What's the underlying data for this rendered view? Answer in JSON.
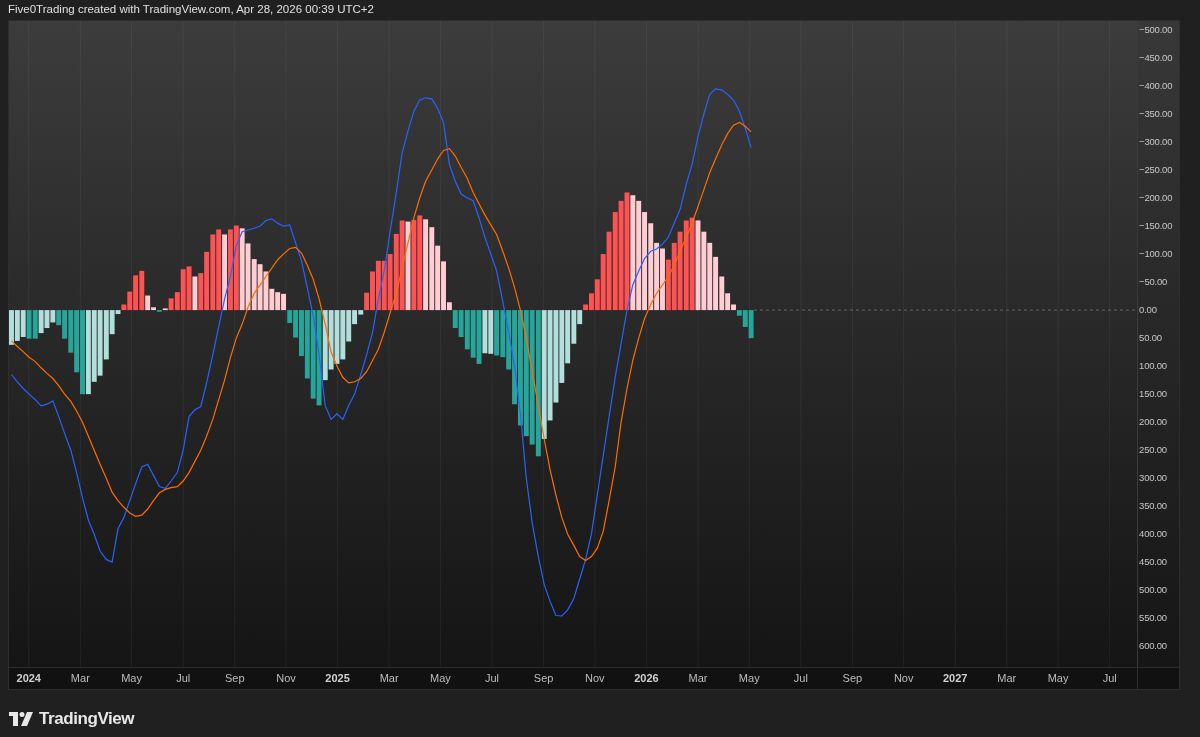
{
  "header": {
    "text": "Five0Trading created with TradingView.com, Apr 28, 2026 00:39 UTC+2"
  },
  "chart": {
    "chart_data": {
      "type": "bar",
      "x": [
        2023.944,
        2023.963,
        2023.982,
        2024.001,
        2024.021,
        2024.04,
        2024.059,
        2024.078,
        2024.097,
        2024.116,
        2024.136,
        2024.155,
        2024.174,
        2024.193,
        2024.212,
        2024.231,
        2024.251,
        2024.27,
        2024.289,
        2024.308,
        2024.327,
        2024.346,
        2024.366,
        2024.385,
        2024.404,
        2024.423,
        2024.442,
        2024.461,
        2024.481,
        2024.5,
        2024.519,
        2024.538,
        2024.557,
        2024.576,
        2024.596,
        2024.615,
        2024.634,
        2024.653,
        2024.672,
        2024.691,
        2024.71,
        2024.73,
        2024.749,
        2024.768,
        2024.787,
        2024.806,
        2024.825,
        2024.845,
        2024.864,
        2024.883,
        2024.902,
        2024.921,
        2024.94,
        2024.96,
        2024.979,
        2024.998,
        2025.017,
        2025.036,
        2025.055,
        2025.075,
        2025.094,
        2025.113,
        2025.132,
        2025.151,
        2025.17,
        2025.19,
        2025.209,
        2025.228,
        2025.247,
        2025.266,
        2025.285,
        2025.305,
        2025.324,
        2025.343,
        2025.362,
        2025.381,
        2025.4,
        2025.42,
        2025.439,
        2025.458,
        2025.477,
        2025.496,
        2025.515,
        2025.535,
        2025.554,
        2025.573,
        2025.592,
        2025.611,
        2025.63,
        2025.65,
        2025.669,
        2025.688,
        2025.707,
        2025.726,
        2025.745,
        2025.765,
        2025.784,
        2025.803,
        2025.822,
        2025.841,
        2025.86,
        2025.879,
        2025.899,
        2025.918,
        2025.937,
        2025.956,
        2025.975,
        2025.994,
        2026.014,
        2026.033,
        2026.052,
        2026.071,
        2026.09,
        2026.109,
        2026.129,
        2026.148,
        2026.167,
        2026.186,
        2026.205,
        2026.224,
        2026.244,
        2026.263,
        2026.282,
        2026.301,
        2026.32,
        2026.339
      ],
      "series": [
        {
          "type": "bar",
          "colors": [
            "#b2dfdb",
            "#b2dfdb",
            "#b2dfdb",
            "#26a69a",
            "#26a69a",
            "#b2dfdb",
            "#b2dfdb",
            "#b2dfdb",
            "#26a69a",
            "#26a69a",
            "#26a69a",
            "#26a69a",
            "#26a69a",
            "#b2dfdb",
            "#b2dfdb",
            "#b2dfdb",
            "#b2dfdb",
            "#b2dfdb",
            "#b2dfdb",
            "#ff5252",
            "#ff5252",
            "#ff5252",
            "#ff5252",
            "#ffcdd2",
            "#ffcdd2",
            "#26a69a",
            "#ffcdd2",
            "#ff5252",
            "#ff5252",
            "#ff5252",
            "#ff5252",
            "#ffcdd2",
            "#ff5252",
            "#ff5252",
            "#ff5252",
            "#ff5252",
            "#ffcdd2",
            "#ff5252",
            "#ff5252",
            "#ffcdd2",
            "#ffcdd2",
            "#ffcdd2",
            "#ffcdd2",
            "#ffcdd2",
            "#ffcdd2",
            "#ffcdd2",
            "#ffcdd2",
            "#26a69a",
            "#26a69a",
            "#26a69a",
            "#26a69a",
            "#26a69a",
            "#26a69a",
            "#b2dfdb",
            "#b2dfdb",
            "#b2dfdb",
            "#b2dfdb",
            "#b2dfdb",
            "#b2dfdb",
            "#b2dfdb",
            "#ff5252",
            "#ff5252",
            "#ff5252",
            "#ff5252",
            "#ff5252",
            "#ff5252",
            "#ff5252",
            "#ffcdd2",
            "#ff5252",
            "#ff5252",
            "#ffcdd2",
            "#ffcdd2",
            "#ffcdd2",
            "#ffcdd2",
            "#ffcdd2",
            "#26a69a",
            "#26a69a",
            "#26a69a",
            "#26a69a",
            "#26a69a",
            "#b2dfdb",
            "#b2dfdb",
            "#26a69a",
            "#26a69a",
            "#26a69a",
            "#26a69a",
            "#26a69a",
            "#26a69a",
            "#26a69a",
            "#26a69a",
            "#b2dfdb",
            "#b2dfdb",
            "#b2dfdb",
            "#b2dfdb",
            "#b2dfdb",
            "#b2dfdb",
            "#b2dfdb",
            "#ff5252",
            "#ff5252",
            "#ff5252",
            "#ff5252",
            "#ff5252",
            "#ff5252",
            "#ff5252",
            "#ff5252",
            "#ffcdd2",
            "#ffcdd2",
            "#ffcdd2",
            "#ffcdd2",
            "#ffcdd2",
            "#ffcdd2",
            "#ff5252",
            "#ff5252",
            "#ff5252",
            "#ff5252",
            "#ff5252",
            "#ffcdd2",
            "#ffcdd2",
            "#ffcdd2",
            "#ffcdd2",
            "#ffcdd2",
            "#ffcdd2",
            "#ffcdd2",
            "#26a69a",
            "#26a69a",
            "#26a69a"
          ],
          "values": [
            62,
            55,
            48,
            51,
            51,
            41,
            32,
            22,
            27,
            51,
            76,
            111,
            150,
            150,
            128,
            117,
            88,
            43,
            7,
            -10,
            -33,
            -62,
            -70,
            -26,
            -5,
            3,
            -3,
            -21,
            -32,
            -73,
            -78,
            -60,
            -66,
            -104,
            -135,
            -144,
            -135,
            -144,
            -151,
            -146,
            -119,
            -91,
            -82,
            -69,
            -38,
            -32,
            -29,
            23,
            49,
            82,
            122,
            158,
            170,
            125,
            106,
            96,
            88,
            56,
            25,
            8,
            -31,
            -69,
            -88,
            -88,
            -100,
            -136,
            -160,
            -158,
            -161,
            -169,
            -162,
            -148,
            -115,
            -87,
            -14,
            32,
            48,
            70,
            85,
            96,
            77,
            78,
            81,
            84,
            106,
            168,
            206,
            225,
            240,
            261,
            230,
            197,
            165,
            130,
            95,
            60,
            25,
            -10,
            -30,
            -55,
            -100,
            -140,
            -175,
            -195,
            -210,
            -205,
            -195,
            -175,
            -155,
            -120,
            -110,
            -90,
            -120,
            -140,
            -160,
            -165,
            -160,
            -140,
            -120,
            -95,
            -60,
            -30,
            -10,
            10,
            30,
            50
          ]
        },
        {
          "type": "line",
          "color": "#2962ff",
          "values": [
            115,
            128,
            140,
            150,
            160,
            171,
            168,
            162,
            190,
            220,
            250,
            290,
            335,
            375,
            400,
            430,
            445,
            450,
            390,
            370,
            340,
            310,
            280,
            275,
            295,
            315,
            318,
            305,
            290,
            250,
            190,
            178,
            172,
            130,
            80,
            30,
            -20,
            -60,
            -115,
            -140,
            -143,
            -146,
            -150,
            -160,
            -163,
            -155,
            -150,
            -152,
            -120,
            -88,
            -40,
            10,
            80,
            170,
            195,
            185,
            195,
            170,
            150,
            115,
            80,
            40,
            -20,
            -70,
            -140,
            -210,
            -280,
            -320,
            -355,
            -375,
            -379,
            -377,
            -360,
            -335,
            -260,
            -230,
            -207,
            -200,
            -195,
            -165,
            -130,
            -100,
            -70,
            -15,
            40,
            100,
            185,
            300,
            380,
            440,
            490,
            520,
            545,
            546,
            535,
            515,
            480,
            445,
            400,
            330,
            260,
            190,
            120,
            60,
            0,
            -45,
            -70,
            -92,
            -105,
            -109,
            -118,
            -130,
            -155,
            -180,
            -225,
            -260,
            -310,
            -350,
            -385,
            -395,
            -393,
            -385,
            -375,
            -355,
            -325,
            -290
          ]
        },
        {
          "type": "line",
          "color": "#ff6d00",
          "values": [
            55,
            65,
            74,
            84,
            92,
            103,
            113,
            122,
            135,
            150,
            163,
            180,
            200,
            225,
            250,
            275,
            300,
            325,
            340,
            352,
            362,
            368,
            366,
            355,
            340,
            326,
            320,
            317,
            315,
            305,
            290,
            270,
            250,
            225,
            195,
            160,
            125,
            85,
            50,
            25,
            -5,
            -30,
            -45,
            -60,
            -75,
            -90,
            -100,
            -110,
            -112,
            -102,
            -80,
            -55,
            -20,
            25,
            75,
            100,
            120,
            130,
            128,
            122,
            110,
            90,
            70,
            40,
            5,
            -30,
            -75,
            -120,
            -165,
            -200,
            -230,
            -250,
            -270,
            -285,
            -288,
            -275,
            -255,
            -235,
            -210,
            -190,
            -170,
            -152,
            -135,
            -105,
            -75,
            -40,
            0,
            50,
            110,
            170,
            230,
            285,
            330,
            370,
            400,
            420,
            440,
            447,
            440,
            425,
            395,
            340,
            280,
            200,
            140,
            90,
            50,
            15,
            -10,
            -30,
            -45,
            -60,
            -80,
            -105,
            -130,
            -155,
            -185,
            -215,
            -245,
            -270,
            -295,
            -315,
            -330,
            -335,
            -328,
            -318
          ]
        }
      ],
      "xlim": [
        2023.936,
        2027.731
      ],
      "ylim": [
        637,
        -516
      ],
      "grid": true,
      "ref_lines": [
        {
          "axis": "y",
          "value": 0
        }
      ],
      "xticks": [
        {
          "value": 2024,
          "label": "2024"
        },
        {
          "value": 2024.167,
          "label": "Mar"
        },
        {
          "value": 2024.333,
          "label": "May"
        },
        {
          "value": 2024.5,
          "label": "Jul"
        },
        {
          "value": 2024.667,
          "label": "Sep"
        },
        {
          "value": 2024.833,
          "label": "Nov"
        },
        {
          "value": 2025,
          "label": "2025"
        },
        {
          "value": 2025.167,
          "label": "Mar"
        },
        {
          "value": 2025.333,
          "label": "May"
        },
        {
          "value": 2025.5,
          "label": "Jul"
        },
        {
          "value": 2025.667,
          "label": "Sep"
        },
        {
          "value": 2025.833,
          "label": "Nov"
        },
        {
          "value": 2026,
          "label": "2026"
        },
        {
          "value": 2026.167,
          "label": "Mar"
        },
        {
          "value": 2026.333,
          "label": "May"
        },
        {
          "value": 2026.5,
          "label": "Jul"
        },
        {
          "value": 2026.667,
          "label": "Sep"
        },
        {
          "value": 2026.833,
          "label": "Nov"
        },
        {
          "value": 2027,
          "label": "2027"
        },
        {
          "value": 2027.167,
          "label": "Mar"
        },
        {
          "value": 2027.333,
          "label": "May"
        },
        {
          "value": 2027.5,
          "label": "Jul"
        }
      ],
      "yticks": [
        {
          "value": -500,
          "label": "−500.00"
        },
        {
          "value": -450,
          "label": "−450.00"
        },
        {
          "value": -400,
          "label": "−400.00"
        },
        {
          "value": -350,
          "label": "−350.00"
        },
        {
          "value": -300,
          "label": "−300.00"
        },
        {
          "value": -250,
          "label": "−250.00"
        },
        {
          "value": -200,
          "label": "−200.00"
        },
        {
          "value": -150,
          "label": "−150.00"
        },
        {
          "value": -100,
          "label": "−100.00"
        },
        {
          "value": -50,
          "label": "−50.00"
        },
        {
          "value": 0,
          "label": "0.00"
        },
        {
          "value": 50,
          "label": "50.00"
        },
        {
          "value": 100,
          "label": "100.00"
        },
        {
          "value": 150,
          "label": "150.00"
        },
        {
          "value": 200,
          "label": "200.00"
        },
        {
          "value": 250,
          "label": "250.00"
        },
        {
          "value": 300,
          "label": "300.00"
        },
        {
          "value": 350,
          "label": "350.00"
        },
        {
          "value": 400,
          "label": "400.00"
        },
        {
          "value": 450,
          "label": "450.00"
        },
        {
          "value": 500,
          "label": "500.00"
        },
        {
          "value": 550,
          "label": "550.00"
        },
        {
          "value": 600,
          "label": "600.00"
        }
      ]
    }
  },
  "footer": {
    "logo_text": "TradingView"
  }
}
